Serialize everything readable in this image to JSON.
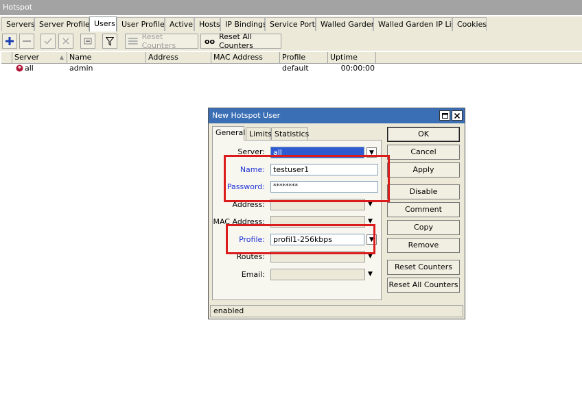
{
  "window_title": "Hotspot",
  "tabs": [
    "Servers",
    "Server Profiles",
    "Users",
    "User Profiles",
    "Active",
    "Hosts",
    "IP Bindings",
    "Service Ports",
    "Walled Garden",
    "Walled Garden IP List",
    "Cookies"
  ],
  "toolbar": {
    "reset_counters": "Reset Counters",
    "reset_all_counters_icon": "oo",
    "reset_all_counters": "Reset All Counters"
  },
  "grid": {
    "columns": [
      "Server",
      "Name",
      "Address",
      "MAC Address",
      "Profile",
      "Uptime"
    ],
    "rows": [
      {
        "server": "all",
        "name": "admin",
        "address": "",
        "mac": "",
        "profile": "default",
        "uptime": "00:00:00"
      }
    ]
  },
  "dialog": {
    "title": "New Hotspot User",
    "tabs": [
      "General",
      "Limits",
      "Statistics"
    ],
    "labels": {
      "server": "Server:",
      "name": "Name:",
      "password": "Password:",
      "address": "Address:",
      "mac": "MAC Address:",
      "profile": "Profile:",
      "routes": "Routes:",
      "email": "Email:"
    },
    "values": {
      "server": "all",
      "name": "testuser1",
      "password": "********",
      "profile": "profil1-256kbps"
    },
    "buttons": [
      "OK",
      "Cancel",
      "Apply",
      "Disable",
      "Comment",
      "Copy",
      "Remove",
      "Reset Counters",
      "Reset All Counters"
    ],
    "status": "enabled"
  },
  "colors": {
    "highlight_box": "#dc1c1c",
    "selection": "#2f5bd1",
    "dialog_title": "#3b6fb5"
  }
}
